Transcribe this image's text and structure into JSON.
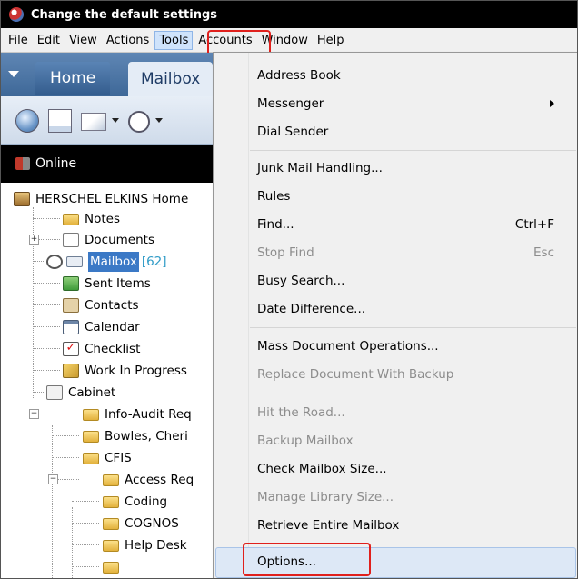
{
  "window": {
    "title": "Change the default settings"
  },
  "menubar": [
    "File",
    "Edit",
    "View",
    "Actions",
    "Tools",
    "Accounts",
    "Window",
    "Help"
  ],
  "ribbon": {
    "tabs": [
      "Home",
      "Mailbox"
    ]
  },
  "status": {
    "online_label": "Online"
  },
  "tree": {
    "root": "HERSCHEL ELKINS Home",
    "items": [
      "Notes",
      "Documents",
      "Mailbox",
      "Sent Items",
      "Contacts",
      "Calendar",
      "Checklist",
      "Work In Progress",
      "Cabinet",
      "Info-Audit Req",
      "Bowles, Cheri",
      "CFIS",
      "Access Req",
      "Coding",
      "COGNOS",
      "Help Desk"
    ],
    "mailbox_count": "[62]"
  },
  "tools_menu": {
    "address_book": "Address Book",
    "messenger": "Messenger",
    "dial_sender": "Dial Sender",
    "junk_mail": "Junk Mail Handling...",
    "rules": "Rules",
    "find": "Find...",
    "find_shortcut": "Ctrl+F",
    "stop_find": "Stop Find",
    "stop_find_shortcut": "Esc",
    "busy_search": "Busy Search...",
    "date_difference": "Date Difference...",
    "mass_doc_ops": "Mass Document Operations...",
    "replace_doc": "Replace Document With Backup",
    "hit_the_road": "Hit the Road...",
    "backup_mailbox": "Backup Mailbox",
    "check_mailbox_size": "Check Mailbox Size...",
    "manage_library_size": "Manage Library Size...",
    "retrieve_mailbox": "Retrieve Entire Mailbox",
    "options": "Options..."
  },
  "colors": {
    "highlight_box": "#e0201c",
    "selection": "#3b79c6",
    "ribbon": "#4a74a6"
  }
}
